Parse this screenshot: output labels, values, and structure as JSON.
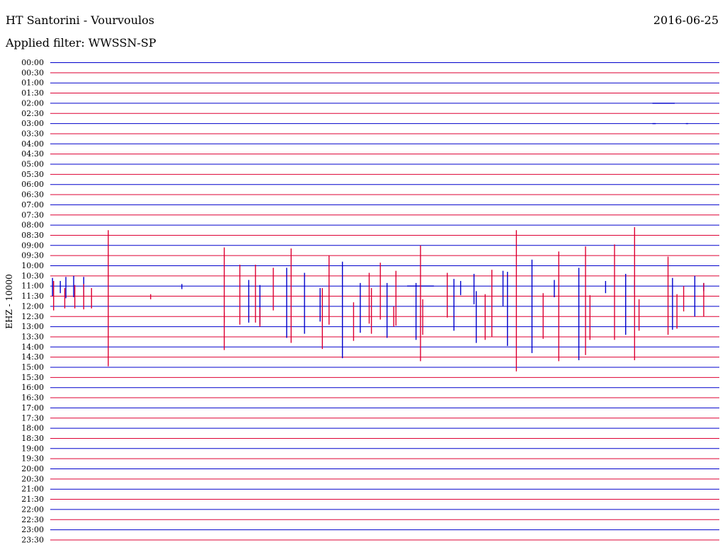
{
  "header": {
    "title": "HT Santorini - Vourvoulos",
    "date": "2016-06-25",
    "filter": "Applied filter: WWSSN-SP"
  },
  "chart_data": {
    "type": "line",
    "ylabel": "EHZ - 10000",
    "line_colors": [
      "#0000cc",
      "#dd0033"
    ],
    "time_labels": [
      "00:00",
      "00:30",
      "01:00",
      "01:30",
      "02:00",
      "02:30",
      "03:00",
      "03:30",
      "04:00",
      "04:30",
      "05:00",
      "05:30",
      "06:00",
      "06:30",
      "07:00",
      "07:30",
      "08:00",
      "08:30",
      "09:00",
      "09:30",
      "10:00",
      "10:30",
      "11:00",
      "11:30",
      "12:00",
      "12:30",
      "13:00",
      "13:30",
      "14:00",
      "14:30",
      "15:00",
      "15:30",
      "16:00",
      "16:30",
      "17:00",
      "17:30",
      "18:00",
      "18:30",
      "19:00",
      "19:30",
      "20:00",
      "20:30",
      "21:00",
      "21:30",
      "22:00",
      "22:30",
      "23:00",
      "23:30"
    ],
    "minutes_per_line": 30,
    "x_range_min": [
      0,
      30
    ],
    "trace_lines": [
      {
        "time": "02:00",
        "events": [
          {
            "t": 27.0,
            "up": 0.0,
            "dn": 0.0,
            "flat": 1.0
          }
        ]
      },
      {
        "time": "03:00",
        "events": [
          {
            "t": 27.0,
            "up": 0.0,
            "dn": 0.0,
            "flat": 0.15
          },
          {
            "t": 28.5,
            "up": 0.0,
            "dn": 0.0,
            "flat": 0.1
          }
        ]
      },
      {
        "time": "11:00",
        "events": [
          {
            "t": 0.1,
            "up": 0.8,
            "dn": 1.0
          },
          {
            "t": 0.45,
            "up": 0.5,
            "dn": 0.7
          },
          {
            "t": 0.7,
            "up": 0.9,
            "dn": 1.2
          },
          {
            "t": 1.05,
            "up": 1.0,
            "dn": 1.1
          },
          {
            "t": 1.5,
            "up": 0.9,
            "dn": 1.0
          },
          {
            "t": 5.9,
            "up": 0.2,
            "dn": 0.3
          },
          {
            "t": 8.5,
            "up": 0.1,
            "dn": 0.1
          },
          {
            "t": 16.0,
            "up": 0.0,
            "dn": 0.0,
            "flat": 1.2
          },
          {
            "t": 18.4,
            "up": 0.5,
            "dn": 0.9
          },
          {
            "t": 19.0,
            "up": 1.2,
            "dn": 1.8
          },
          {
            "t": 20.3,
            "up": 1.5,
            "dn": 2.0
          },
          {
            "t": 22.6,
            "up": 0.6,
            "dn": 1.1
          },
          {
            "t": 24.9,
            "up": 0.5,
            "dn": 0.7
          },
          {
            "t": 26.2,
            "up": 0.6,
            "dn": 0.8
          },
          {
            "t": 29.3,
            "up": 0.3,
            "dn": 0.5
          }
        ]
      },
      {
        "time": "11:30",
        "events": [
          {
            "t": 0.15,
            "up": 1.5,
            "dn": 1.4
          },
          {
            "t": 0.65,
            "up": 0.8,
            "dn": 1.2
          },
          {
            "t": 1.1,
            "up": 1.1,
            "dn": 1.2
          },
          {
            "t": 1.5,
            "up": 1.2,
            "dn": 1.3
          },
          {
            "t": 1.85,
            "up": 0.8,
            "dn": 1.2
          },
          {
            "t": 2.6,
            "up": 6.5,
            "dn": 6.9
          },
          {
            "t": 4.5,
            "up": 0.2,
            "dn": 0.3
          },
          {
            "t": 7.8,
            "up": 4.8,
            "dn": 5.3
          },
          {
            "t": 8.5,
            "up": 3.1,
            "dn": 2.8
          },
          {
            "t": 9.2,
            "up": 3.1,
            "dn": 2.6
          },
          {
            "t": 10.0,
            "up": 2.8,
            "dn": 1.4
          },
          {
            "t": 10.8,
            "up": 4.7,
            "dn": 4.6
          },
          {
            "t": 12.5,
            "up": 4.0,
            "dn": 2.8
          },
          {
            "t": 14.3,
            "up": 2.3,
            "dn": 2.7
          },
          {
            "t": 14.8,
            "up": 3.3,
            "dn": 2.3
          },
          {
            "t": 15.5,
            "up": 2.5,
            "dn": 2.9
          },
          {
            "t": 16.6,
            "up": 5.0,
            "dn": 6.4
          },
          {
            "t": 17.8,
            "up": 2.3,
            "dn": 2.1
          },
          {
            "t": 19.8,
            "up": 2.6,
            "dn": 4.0
          },
          {
            "t": 20.9,
            "up": 6.5,
            "dn": 7.4
          },
          {
            "t": 22.8,
            "up": 4.4,
            "dn": 6.4
          },
          {
            "t": 24.0,
            "up": 4.9,
            "dn": 5.8
          },
          {
            "t": 25.3,
            "up": 5.1,
            "dn": 4.3
          },
          {
            "t": 26.2,
            "up": 6.8,
            "dn": 6.3
          },
          {
            "t": 27.7,
            "up": 3.9,
            "dn": 3.8
          },
          {
            "t": 28.4,
            "up": 1.0,
            "dn": 1.5
          },
          {
            "t": 29.3,
            "up": 1.3,
            "dn": 2.0
          }
        ]
      },
      {
        "time": "12:00",
        "events": [
          {
            "t": 8.9,
            "up": 2.6,
            "dn": 1.6
          },
          {
            "t": 9.4,
            "up": 2.1,
            "dn": 1.8
          },
          {
            "t": 10.6,
            "up": 3.8,
            "dn": 3.1
          },
          {
            "t": 11.4,
            "up": 3.3,
            "dn": 2.7
          },
          {
            "t": 12.1,
            "up": 1.8,
            "dn": 1.5
          },
          {
            "t": 13.1,
            "up": 4.4,
            "dn": 5.1
          },
          {
            "t": 13.9,
            "up": 2.3,
            "dn": 2.6
          },
          {
            "t": 15.1,
            "up": 2.3,
            "dn": 3.1
          },
          {
            "t": 16.4,
            "up": 2.3,
            "dn": 3.3
          },
          {
            "t": 18.1,
            "up": 2.7,
            "dn": 2.4
          },
          {
            "t": 19.1,
            "up": 1.5,
            "dn": 3.6
          },
          {
            "t": 20.5,
            "up": 3.4,
            "dn": 3.9
          },
          {
            "t": 21.6,
            "up": 4.6,
            "dn": 4.6
          },
          {
            "t": 23.7,
            "up": 3.8,
            "dn": 5.3
          },
          {
            "t": 25.8,
            "up": 3.2,
            "dn": 2.8
          },
          {
            "t": 27.9,
            "up": 2.8,
            "dn": 2.3
          },
          {
            "t": 28.9,
            "up": 3.0,
            "dn": 1.0
          }
        ]
      },
      {
        "time": "12:30",
        "events": [
          {
            "t": 7.8,
            "up": 0.4,
            "dn": 0.6
          },
          {
            "t": 9.4,
            "up": 0.9,
            "dn": 1.0
          },
          {
            "t": 12.2,
            "up": 2.8,
            "dn": 3.2
          },
          {
            "t": 13.6,
            "up": 1.4,
            "dn": 2.4
          },
          {
            "t": 14.4,
            "up": 2.8,
            "dn": 1.7
          },
          {
            "t": 15.4,
            "up": 1.0,
            "dn": 1.0
          },
          {
            "t": 16.7,
            "up": 1.7,
            "dn": 1.8
          },
          {
            "t": 19.5,
            "up": 2.2,
            "dn": 2.3
          },
          {
            "t": 22.1,
            "up": 2.3,
            "dn": 2.2
          },
          {
            "t": 24.2,
            "up": 2.1,
            "dn": 2.3
          },
          {
            "t": 26.4,
            "up": 1.7,
            "dn": 1.4
          },
          {
            "t": 28.1,
            "up": 2.2,
            "dn": 1.2
          }
        ]
      }
    ]
  }
}
